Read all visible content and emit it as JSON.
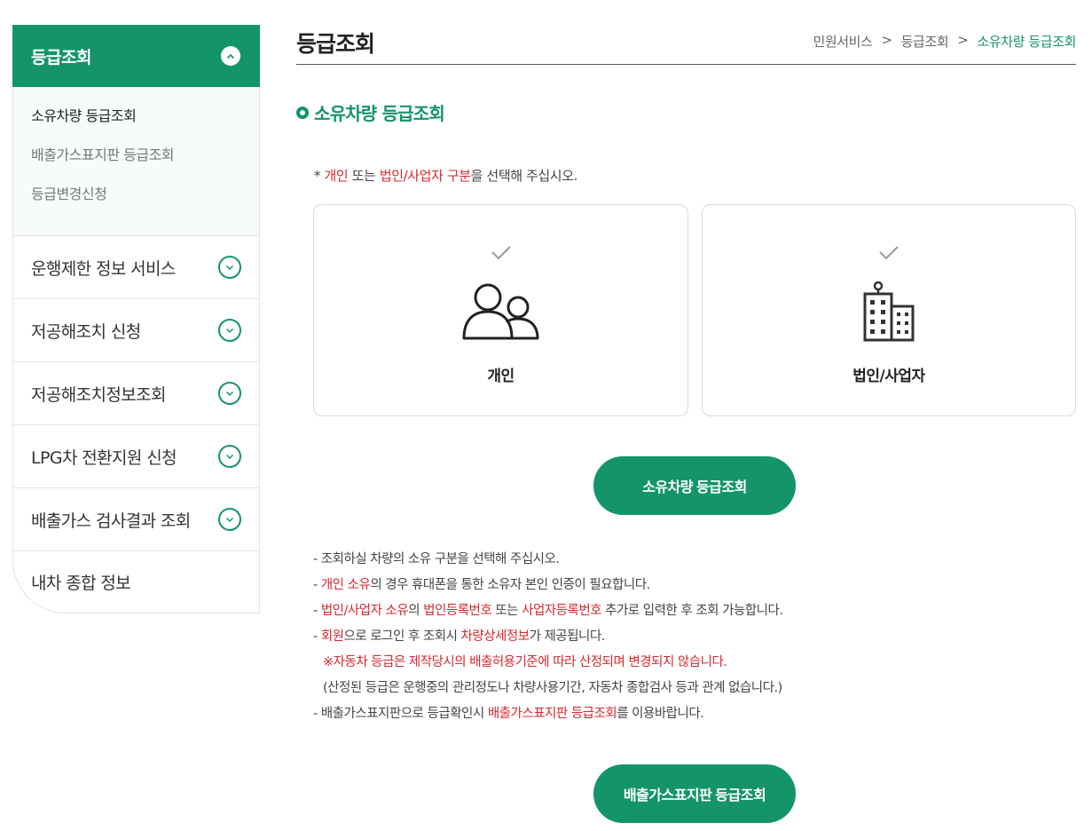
{
  "sidebar": {
    "header": "등급조회",
    "submenu": [
      "소유차량 등급조회",
      "배출가스표지판 등급조회",
      "등급변경신청"
    ],
    "items": [
      "운행제한 정보 서비스",
      "저공해조치 신청",
      "저공해조치정보조회",
      "LPG차 전환지원 신청",
      "배출가스 검사결과 조회",
      "내차 종합 정보"
    ]
  },
  "header": {
    "title": "등급조회",
    "breadcrumb": [
      "민원서비스",
      ">",
      "등급조회",
      ">",
      "소유차량 등급조회"
    ]
  },
  "section": {
    "title": "소유차량 등급조회"
  },
  "notice": {
    "prefix": "* ",
    "red1": "개인",
    "mid1": " 또는 ",
    "red2": "법인/사업자 구분",
    "suffix": "을 선택해 주십시오."
  },
  "cards": {
    "person": "개인",
    "corp": "법인/사업자"
  },
  "buttons": {
    "primary": "소유차량 등급조회",
    "secondary": "배출가스표지판 등급조회"
  },
  "guide": {
    "l1": "- 조회하실 차량의 소유 구분을 선택해 주십시오.",
    "l2_dash": "- ",
    "l2_red": "개인 소유",
    "l2_rest": "의 경우 휴대폰을 통한 소유자 본인 인증이 필요합니다.",
    "l3_dash": "- ",
    "l3_red1": "법인/사업자 소유",
    "l3_mid1": "의 ",
    "l3_red2": "법인등록번호",
    "l3_mid2": " 또는 ",
    "l3_red3": "사업자등록번호",
    "l3_rest": " 추가로 입력한 후 조회 가능합니다.",
    "l4_dash": "- ",
    "l4_red1": "회원",
    "l4_mid": "으로 로그인 후 조회시 ",
    "l4_red2": "차량상세정보",
    "l4_rest": "가 제공됩니다.",
    "l5": "※자동차 등급은 제작당시의 배출허용기준에 따라 산정되며 변경되지 않습니다.",
    "l6": "(산정된 등급은 운행중의 관리정도나 차량사용기간, 자동차 종합검사 등과 관계 없습니다.)",
    "l7_pre": "- 배출가스표지판으로 등급확인시 ",
    "l7_red": "배출가스표지판 등급조회",
    "l7_rest": "를 이용바랍니다."
  },
  "colors": {
    "accent": "#14946a",
    "highlight": "#d7282f"
  }
}
